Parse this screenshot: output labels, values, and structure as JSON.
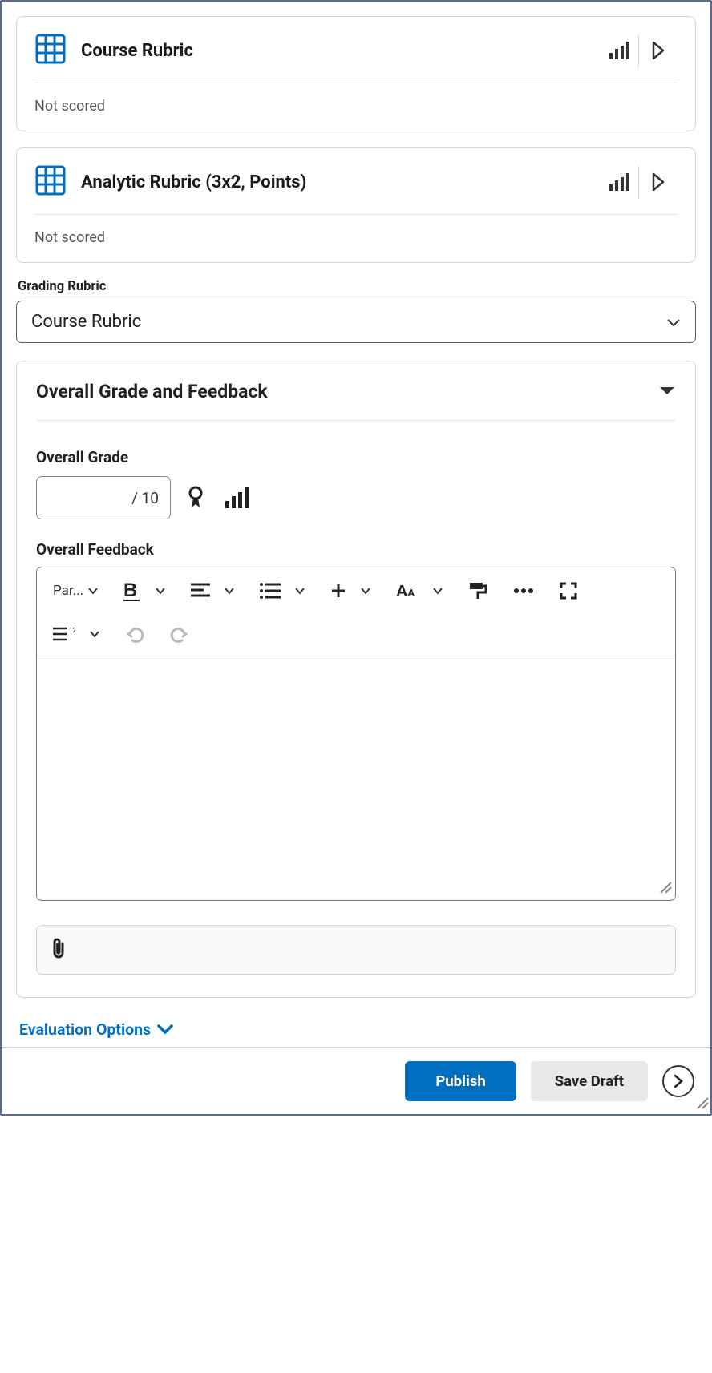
{
  "rubrics": [
    {
      "title": "Course Rubric",
      "status": "Not scored"
    },
    {
      "title": "Analytic Rubric (3x2, Points)",
      "status": "Not scored"
    }
  ],
  "grading_rubric_label": "Grading Rubric",
  "grading_rubric_selected": "Course Rubric",
  "panel": {
    "title": "Overall Grade and Feedback",
    "grade_label": "Overall Grade",
    "grade_value": "",
    "grade_denom": "/ 10",
    "feedback_label": "Overall Feedback",
    "feedback_value": ""
  },
  "toolbar": {
    "block_label": "Par..."
  },
  "eval_options_label": "Evaluation Options",
  "footer": {
    "publish": "Publish",
    "save_draft": "Save Draft"
  }
}
